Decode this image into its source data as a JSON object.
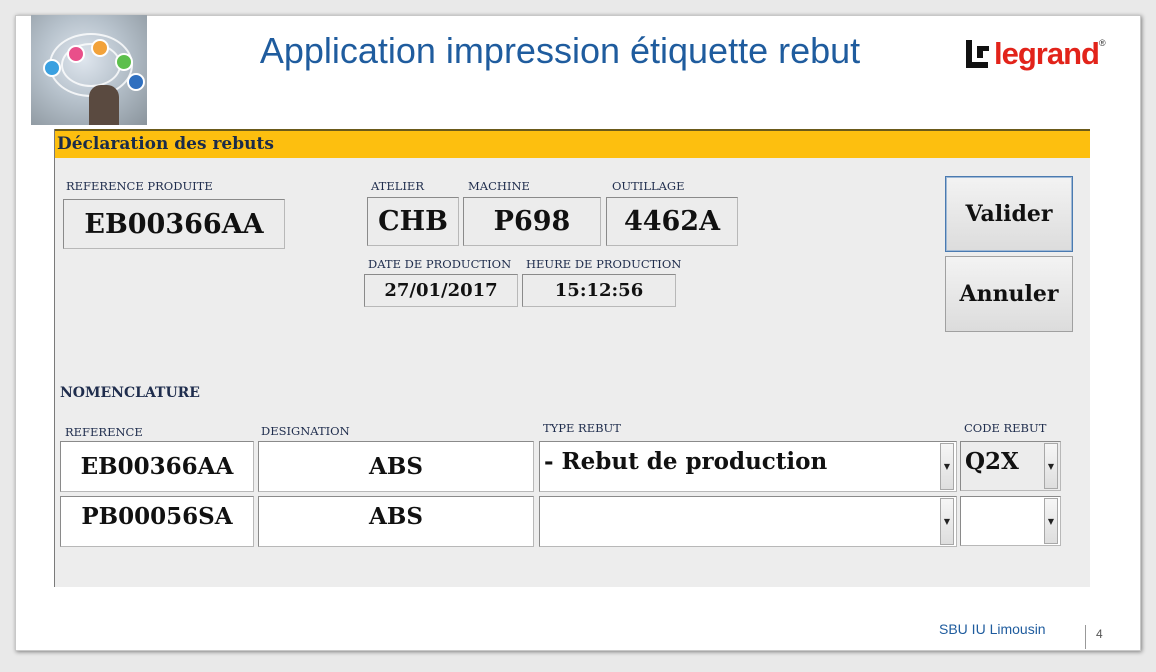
{
  "slide": {
    "title": "Application impression étiquette rebut",
    "logo_text": "legrand",
    "logo_reg": "®",
    "footer": "SBU IU Limousin",
    "page_number": "4"
  },
  "form": {
    "header": "Déclaration des rebuts",
    "reference_produite": {
      "label": "REFERENCE PRODUITE",
      "value": "EB00366AA"
    },
    "atelier": {
      "label": "ATELIER",
      "value": "CHB"
    },
    "machine": {
      "label": "MACHINE",
      "value": "P698"
    },
    "outillage": {
      "label": "OUTILLAGE",
      "value": "4462A"
    },
    "date_production": {
      "label": "DATE DE PRODUCTION",
      "value": "27/01/2017"
    },
    "heure_production": {
      "label": "HEURE DE PRODUCTION",
      "value": "15:12:56"
    },
    "buttons": {
      "validate": "Valider",
      "cancel": "Annuler"
    },
    "nomenclature": {
      "title": "NOMENCLATURE",
      "columns": {
        "reference": "REFERENCE",
        "designation": "DESIGNATION",
        "type_rebut": "TYPE REBUT",
        "code_rebut": "CODE REBUT"
      },
      "rows": [
        {
          "reference": "EB00366AA",
          "designation": "ABS",
          "type_rebut": "- Rebut de production",
          "code_rebut": "Q2X"
        },
        {
          "reference": "PB00056SA",
          "designation": "ABS",
          "type_rebut": "",
          "code_rebut": ""
        }
      ]
    }
  }
}
